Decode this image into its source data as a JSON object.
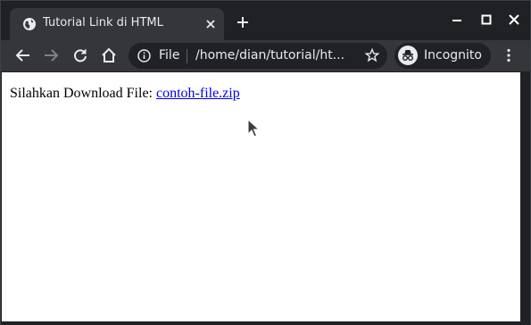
{
  "tab": {
    "title": "Tutorial Link di HTML"
  },
  "address_bar": {
    "scheme_label": "File",
    "url": "/home/dian/tutorial/ht..."
  },
  "incognito": {
    "label": "Incognito"
  },
  "page": {
    "prefix_text": "Silahkan Download File: ",
    "link_text": "contoh-file.zip"
  }
}
